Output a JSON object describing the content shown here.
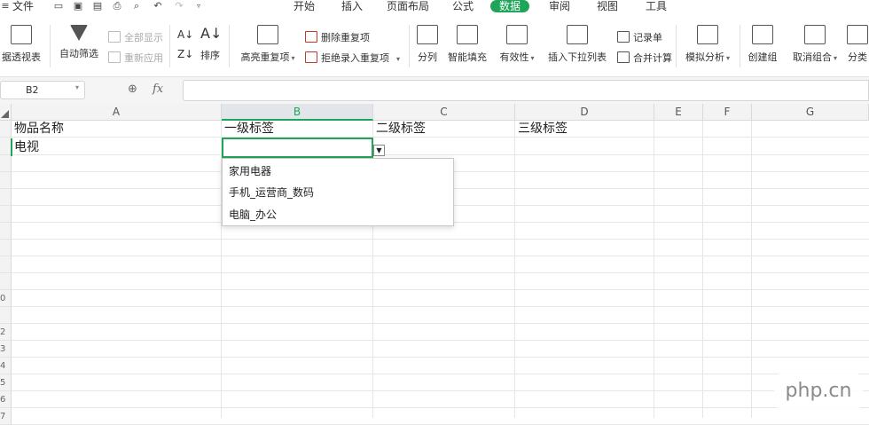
{
  "menubar": {
    "file_label": "文件",
    "tabs": [
      "开始",
      "插入",
      "页面布局",
      "公式",
      "数据",
      "审阅",
      "视图",
      "工具"
    ],
    "active_tab": "数据"
  },
  "ribbon": {
    "pivot_label": "据透视表",
    "autofilter_label": "自动筛选",
    "show_all_label": "全部显示",
    "reapply_label": "重新应用",
    "sort_label": "排序",
    "highlight_dup_label": "高亮重复项",
    "remove_dup_label": "删除重复项",
    "reject_dup_label": "拒绝录入重复项",
    "split_label": "分列",
    "smart_fill_label": "智能填充",
    "validity_label": "有效性",
    "insert_dropdown_label": "插入下拉列表",
    "record_label": "记录单",
    "consolidate_label": "合并计算",
    "whatif_label": "模拟分析",
    "group_label": "创建组",
    "ungroup_label": "取消组合",
    "subtotal_label": "分类"
  },
  "formula_bar": {
    "cell_ref": "B2",
    "fx_label": "fx",
    "value": ""
  },
  "grid": {
    "columns": [
      "A",
      "B",
      "C",
      "D",
      "E",
      "F",
      "G"
    ],
    "selected_column": "B",
    "row_numbers": [
      "",
      "",
      "",
      "",
      "",
      "",
      "",
      "",
      "",
      "",
      "0",
      "",
      "2",
      "3",
      "4",
      "5",
      "6",
      "7"
    ],
    "cells": {
      "A1": "物品名称",
      "B1": "一级标签",
      "C1": "二级标签",
      "D1": "三级标签",
      "A2": "电视"
    }
  },
  "dropdown": {
    "options": [
      "家用电器",
      "手机_运营商_数码",
      "电脑_办公"
    ]
  },
  "watermark": "php.cn"
}
